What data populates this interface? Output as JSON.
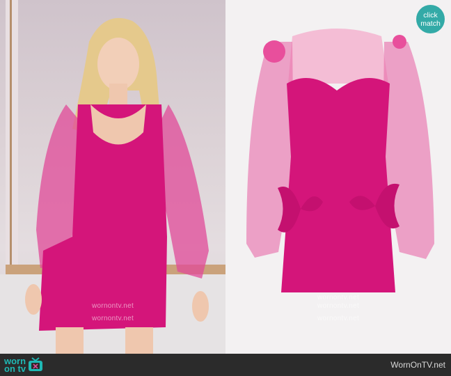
{
  "watermark_text": "wornontv.net",
  "brand": {
    "line1": "worn",
    "line2": "on tv",
    "accent": "#1fb9b5"
  },
  "footer": {
    "site": "WornOnTV.net"
  },
  "badge": {
    "line1": "click",
    "line2": "match",
    "color": "#33aaa7"
  },
  "colors": {
    "dress": "#d4157a",
    "dress_dark": "#a50e5e",
    "bar": "#2b2b2b"
  }
}
